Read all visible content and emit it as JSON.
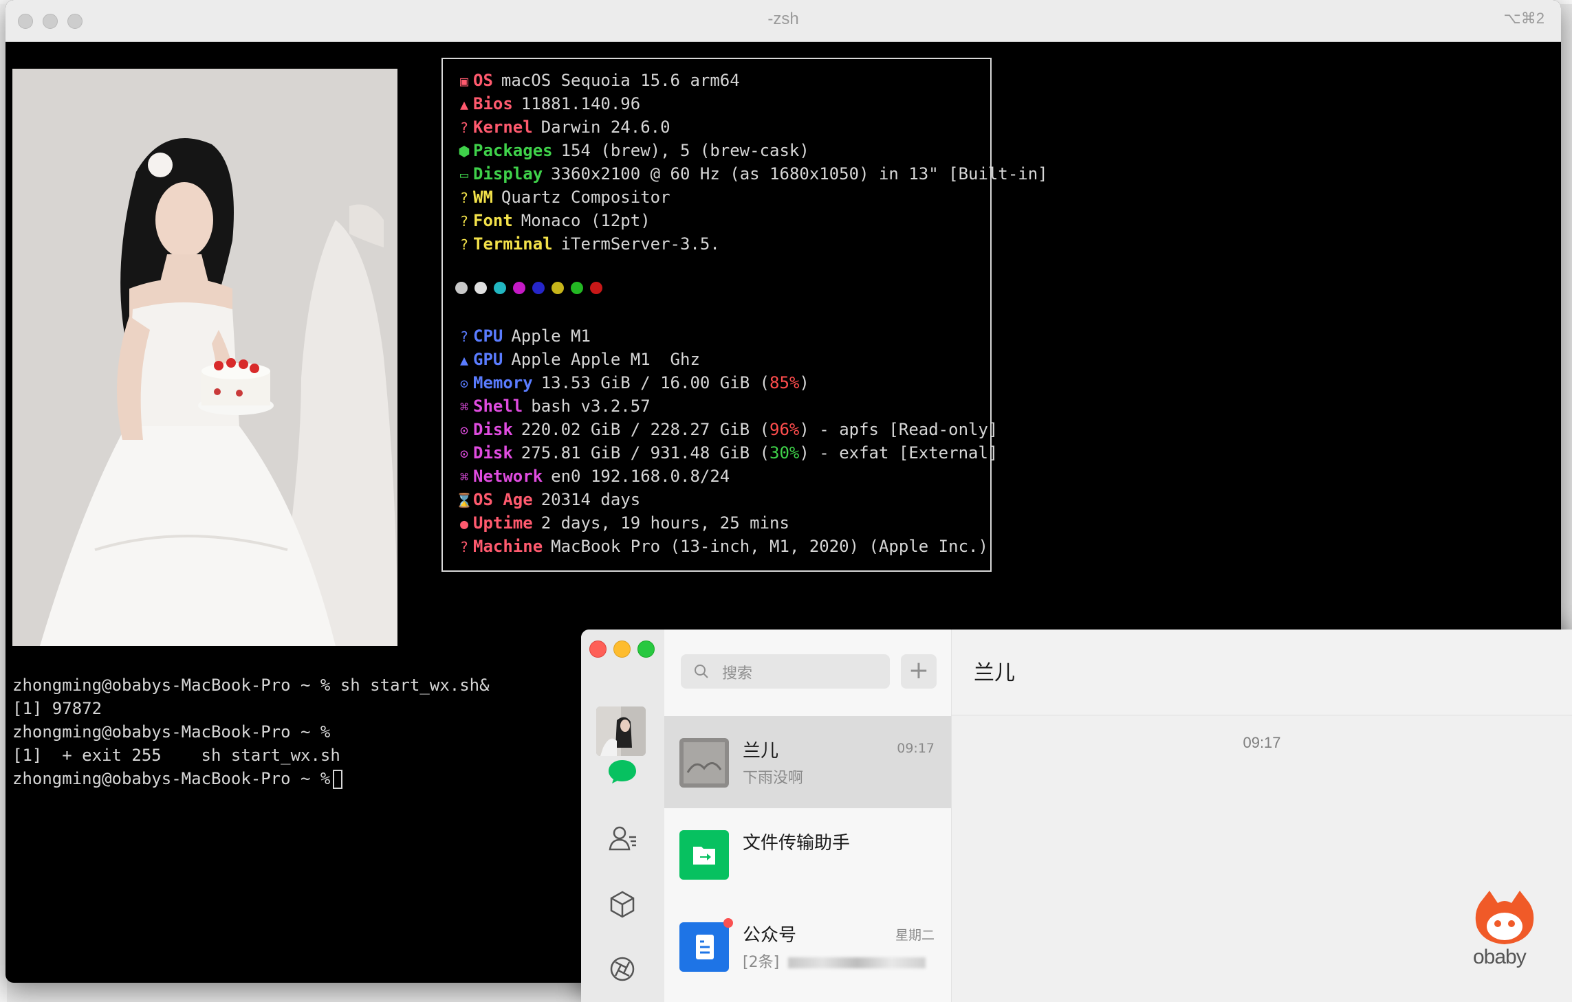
{
  "terminal": {
    "title": "-zsh",
    "shortcut": "⌥⌘2",
    "info": [
      {
        "icon": "▣",
        "key": "OS",
        "value": "macOS Sequoia 15.6 arm64",
        "color": "#ff5a6e"
      },
      {
        "icon": "▲",
        "key": "Bios",
        "value": "11881.140.96",
        "color": "#ff5a6e"
      },
      {
        "icon": "?",
        "key": "Kernel",
        "value": "Darwin 24.6.0",
        "color": "#ff5a6e"
      },
      {
        "icon": "⬢",
        "key": "Packages",
        "value": "154 (brew), 5 (brew-cask)",
        "color": "#3fd24a"
      },
      {
        "icon": "▭",
        "key": "Display",
        "value": "3360x2100 @ 60 Hz (as 1680x1050) in 13\" [Built-in]",
        "color": "#3fd24a"
      },
      {
        "icon": "?",
        "key": "WM",
        "value": "Quartz Compositor",
        "color": "#f3e24a"
      },
      {
        "icon": "?",
        "key": "Font",
        "value": "Monaco (12pt)",
        "color": "#f3e24a"
      },
      {
        "icon": "?",
        "key": "Terminal",
        "value": "iTermServer-3.5.",
        "color": "#f3e24a"
      }
    ],
    "color_dots": [
      "#c8c8c8",
      "#e0e0e0",
      "#22b7c1",
      "#c51ac6",
      "#2626c9",
      "#c7b51a",
      "#23b823",
      "#c81818"
    ],
    "info2": [
      {
        "icon": "?",
        "key": "CPU",
        "value": "Apple M1",
        "color": "#5a7cff"
      },
      {
        "icon": "▲",
        "key": "GPU",
        "value": "Apple Apple M1  Ghz",
        "color": "#5a7cff"
      },
      {
        "icon": "⊙",
        "key": "Memory",
        "value_pre": "13.53 GiB / 16.00 GiB (",
        "value_pct": "85%",
        "value_post": ")",
        "pct_color": "#ff4d4d",
        "color": "#5a7cff"
      },
      {
        "icon": "⌘",
        "key": "Shell",
        "value": "bash v3.2.57",
        "color": "#e04ce0"
      },
      {
        "icon": "⊙",
        "key": "Disk",
        "value_pre": "220.02 GiB / 228.27 GiB (",
        "value_pct": "96%",
        "value_post": ") - apfs [Read-only]",
        "pct_color": "#ff4d4d",
        "color": "#e04ce0"
      },
      {
        "icon": "⊙",
        "key": "Disk",
        "value_pre": "275.81 GiB / 931.48 GiB (",
        "value_pct": "30%",
        "value_post": ") - exfat [External]",
        "pct_color": "#3fd24a",
        "color": "#e04ce0"
      },
      {
        "icon": "⌘",
        "key": "Network",
        "value": "en0 192.168.0.8/24",
        "color": "#e04ce0"
      },
      {
        "icon": "⌛",
        "key": "OS Age",
        "value": "20314 days",
        "color": "#ff5a6e"
      },
      {
        "icon": "●",
        "key": "Uptime",
        "value": "2 days, 19 hours, 25 mins",
        "color": "#ff5a6e"
      },
      {
        "icon": "?",
        "key": "Machine",
        "value": "MacBook Pro (13-inch, M1, 2020) (Apple Inc.)",
        "color": "#ff5a6e"
      }
    ],
    "prompt_lines": [
      "zhongming@obabys-MacBook-Pro ~ % sh start_wx.sh&",
      "[1] 97872",
      "zhongming@obabys-MacBook-Pro ~ %",
      "[1]  + exit 255    sh start_wx.sh",
      "zhongming@obabys-MacBook-Pro ~ %"
    ]
  },
  "wechat": {
    "search_placeholder": "搜索",
    "add_label": "+",
    "conversations": [
      {
        "name": "兰儿",
        "preview": "下雨没啊",
        "time": "09:17",
        "selected": true
      },
      {
        "name": "文件传输助手",
        "preview": "",
        "time": "",
        "selected": false
      },
      {
        "name": "公众号",
        "preview": "[2条]",
        "time": "星期二",
        "selected": false
      }
    ],
    "chat_title": "兰儿",
    "chat_time": "09:17"
  },
  "watermark": {
    "text": "obaby"
  },
  "colors": {
    "wechat_green": "#07c160",
    "official_blue": "#1e74e6",
    "badge_red": "#fa5151"
  }
}
